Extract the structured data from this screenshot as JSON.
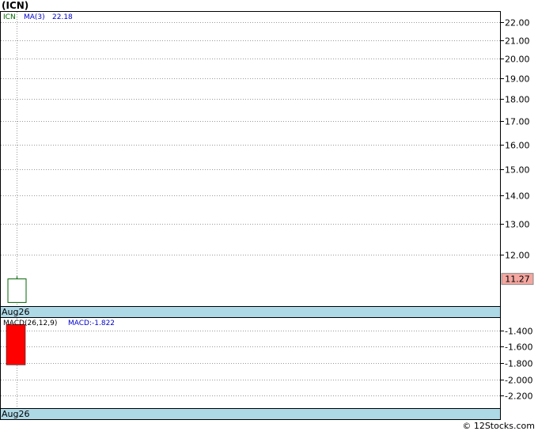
{
  "title": "(ICN)",
  "watermark": "© 12Stocks.com",
  "colors": {
    "background": "#ffffff",
    "date_band": "#add8e6",
    "grid": "#999999",
    "ticker_text": "#006400",
    "ma_text": "#0000cd",
    "candle_border": "#006400",
    "macd_bar": "#ff0000",
    "last_price_fill": "#f4a7a0"
  },
  "chart_data": [
    {
      "type": "candlestick",
      "legend": {
        "ticker": "ICN",
        "ma_label": "MA(3)",
        "ma_value": "22.18"
      },
      "yticks": [
        "22.00",
        "21.00",
        "20.00",
        "19.00",
        "18.00",
        "17.00",
        "16.00",
        "15.00",
        "14.00",
        "13.00",
        "12.00"
      ],
      "ytick_values": [
        22,
        21,
        20,
        19,
        18,
        17,
        16,
        15,
        14,
        13,
        12
      ],
      "y_scale": "log",
      "ylim": [
        10.5,
        22.6
      ],
      "grid": true,
      "last_price": "11.27",
      "x_label": "Aug26",
      "candles": [
        {
          "date": "Aug26",
          "open": 10.6,
          "high": 11.35,
          "low": 10.6,
          "close": 11.27
        }
      ]
    },
    {
      "type": "bar",
      "legend": {
        "indicator": "MACD(26,12,9)",
        "value_label": "MACD:-1.822"
      },
      "yticks": [
        "-1.400",
        "-1.600",
        "-1.800",
        "-2.000",
        "-2.200"
      ],
      "ytick_values": [
        -1.4,
        -1.6,
        -1.8,
        -2.0,
        -2.2
      ],
      "ylim": [
        -2.35,
        -1.25
      ],
      "grid": true,
      "x_label": "Aug26",
      "bars": [
        {
          "date": "Aug26",
          "from": -1.33,
          "to": -1.822
        }
      ]
    }
  ]
}
